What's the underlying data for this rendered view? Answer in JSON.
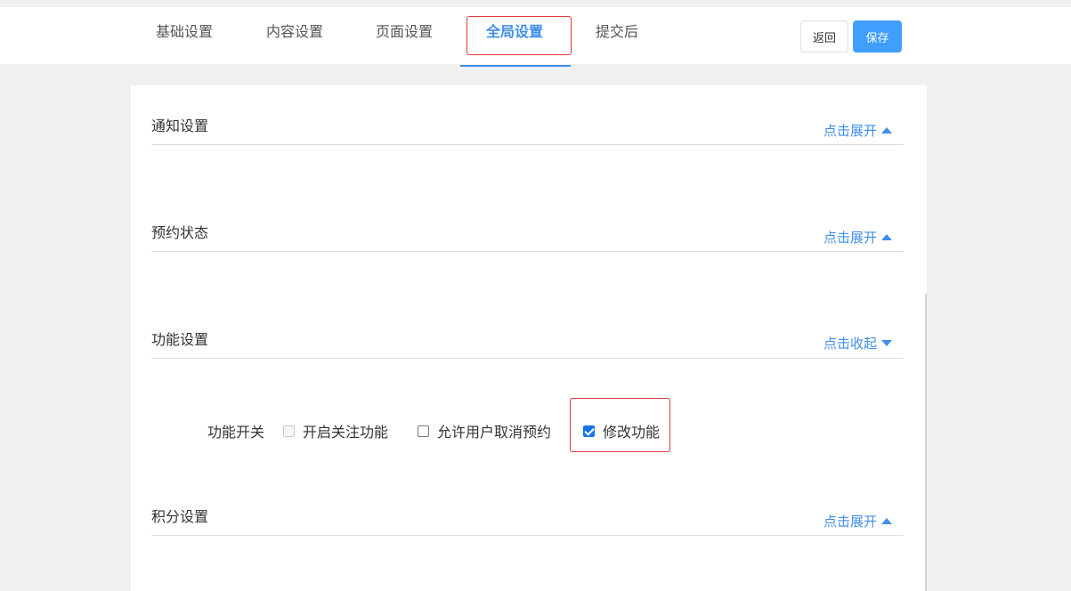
{
  "tabs": [
    {
      "label": "基础设置",
      "active": false
    },
    {
      "label": "内容设置",
      "active": false
    },
    {
      "label": "页面设置",
      "active": false
    },
    {
      "label": "全局设置",
      "active": true
    },
    {
      "label": "提交后",
      "active": false
    }
  ],
  "header": {
    "back_label": "返回",
    "save_label": "保存"
  },
  "sections": [
    {
      "title": "通知设置",
      "toggle_label": "点击展开",
      "expanded": false
    },
    {
      "title": "预约状态",
      "toggle_label": "点击展开",
      "expanded": false
    },
    {
      "title": "功能设置",
      "toggle_label": "点击收起",
      "expanded": true
    },
    {
      "title": "积分设置",
      "toggle_label": "点击展开",
      "expanded": false
    }
  ],
  "feature_settings": {
    "field_label": "功能开关",
    "options": [
      {
        "label": "开启关注功能",
        "checked": false,
        "disabled": true
      },
      {
        "label": "允许用户取消预约",
        "checked": false,
        "disabled": false
      },
      {
        "label": "修改功能",
        "checked": true,
        "disabled": false
      }
    ]
  },
  "colors": {
    "accent": "#3f8ee8",
    "primary_button": "#409eff",
    "highlight_border": "#e0393e",
    "background": "#f0f0f0"
  }
}
